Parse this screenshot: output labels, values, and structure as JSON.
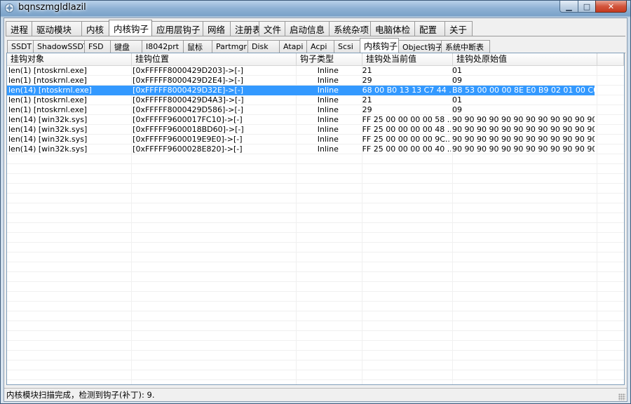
{
  "window": {
    "title": "bqnszmgldlazil",
    "controls": {
      "minimize": "▁",
      "maximize": "□",
      "close": "✕"
    }
  },
  "main_tabs": [
    {
      "label": "进程"
    },
    {
      "label": "驱动模块"
    },
    {
      "label": "内核"
    },
    {
      "label": "内核钩子",
      "active": true
    },
    {
      "label": "应用层钩子"
    },
    {
      "label": "网络"
    },
    {
      "label": "注册表"
    },
    {
      "label": "文件"
    },
    {
      "label": "启动信息"
    },
    {
      "label": "系统杂项"
    },
    {
      "label": "电脑体检"
    },
    {
      "label": "配置"
    },
    {
      "label": "关于"
    }
  ],
  "sub_tabs": [
    {
      "label": "SSDT"
    },
    {
      "label": "ShadowSSDT"
    },
    {
      "label": "FSD"
    },
    {
      "label": "键盘"
    },
    {
      "label": "I8042prt"
    },
    {
      "label": "鼠标"
    },
    {
      "label": "Partmgr"
    },
    {
      "label": "Disk"
    },
    {
      "label": "Atapi"
    },
    {
      "label": "Acpi"
    },
    {
      "label": "Scsi"
    },
    {
      "label": "内核钩子",
      "active": true
    },
    {
      "label": "Object钩子"
    },
    {
      "label": "系统中断表"
    }
  ],
  "table": {
    "columns": [
      "挂钩对象",
      "挂钩位置",
      "钩子类型",
      "挂钩处当前值",
      "挂钩处原始值"
    ],
    "rows": [
      [
        "len(1) [ntoskrnl.exe]",
        "[0xFFFFF8000429D203]->[-]",
        "Inline",
        "21",
        "01"
      ],
      [
        "len(1) [ntoskrnl.exe]",
        "[0xFFFFF8000429D2E4]->[-]",
        "Inline",
        "29",
        "09"
      ],
      [
        "len(14) [ntoskrnl.exe]",
        "[0xFFFFF8000429D32E]->[-]",
        "Inline",
        "68 00 B0 13 13 C7 44 ...",
        "B8 53 00 00 00 8E E0 B9 02 01 00 C0 ..."
      ],
      [
        "len(1) [ntoskrnl.exe]",
        "[0xFFFFF8000429D4A3]->[-]",
        "Inline",
        "21",
        "01"
      ],
      [
        "len(1) [ntoskrnl.exe]",
        "[0xFFFFF8000429D586]->[-]",
        "Inline",
        "29",
        "09"
      ],
      [
        "len(14) [win32k.sys]",
        "[0xFFFFF9600017FC10]->[-]",
        "Inline",
        "FF 25 00 00 00 00 58 ...",
        "90 90 90 90 90 90 90 90 90 90 90 90 ..."
      ],
      [
        "len(14) [win32k.sys]",
        "[0xFFFFF9600018BD60]->[-]",
        "Inline",
        "FF 25 00 00 00 00 48 ...",
        "90 90 90 90 90 90 90 90 90 90 90 90 ..."
      ],
      [
        "len(14) [win32k.sys]",
        "[0xFFFFF9600019E9E0]->[-]",
        "Inline",
        "FF 25 00 00 00 00 9C...",
        "90 90 90 90 90 90 90 90 90 90 90 90 ..."
      ],
      [
        "len(14) [win32k.sys]",
        "[0xFFFFF9600028E820]->[-]",
        "Inline",
        "FF 25 00 00 00 00 40 ...",
        "90 90 90 90 90 90 90 90 90 90 90 90 ..."
      ]
    ],
    "selected_row": 2
  },
  "status": {
    "text": "内核模块扫描完成，检测到钩子(补丁): 9."
  },
  "colors": {
    "selection": "#3399ff",
    "titlebar": "#8eb1d4"
  }
}
